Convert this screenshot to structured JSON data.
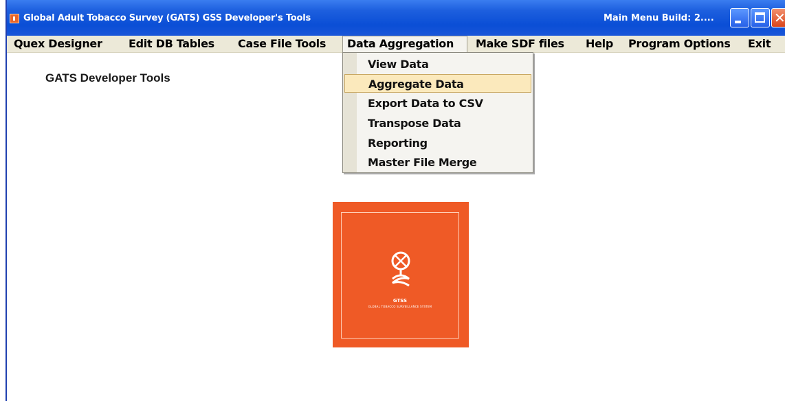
{
  "window": {
    "title": "Global Adult Tobacco Survey (GATS) GSS Developer's Tools",
    "build_label": "Main Menu Build: 2....",
    "controls": [
      "minimize-icon",
      "maximize-icon",
      "close-icon"
    ]
  },
  "menubar": {
    "items": [
      {
        "label": "Quex Designer"
      },
      {
        "label": "Edit DB Tables"
      },
      {
        "label": "Case File Tools"
      },
      {
        "label": "Data Aggregation",
        "active": true
      },
      {
        "label": "Make SDF files"
      },
      {
        "label": "Help"
      },
      {
        "label": "Program Options"
      },
      {
        "label": "Exit"
      }
    ]
  },
  "dropdown": {
    "parent": "Data Aggregation",
    "items": [
      {
        "label": "View Data"
      },
      {
        "label": "Aggregate Data",
        "highlighted": true
      },
      {
        "label": "Export Data to CSV"
      },
      {
        "label": "Transpose Data"
      },
      {
        "label": "Reporting"
      },
      {
        "label": "Master File Merge"
      }
    ]
  },
  "content": {
    "heading": "GATS Developer Tools"
  },
  "logo": {
    "name": "GTSS",
    "subtitle": "GLOBAL TOBACCO SURVEILLANCE SYSTEM",
    "icon": "globe-icon",
    "background_color": "#ef5a26"
  },
  "colors": {
    "titlebar": "#0a4ed6",
    "menubar": "#ece9d8",
    "highlight": "#fbe9bc"
  }
}
